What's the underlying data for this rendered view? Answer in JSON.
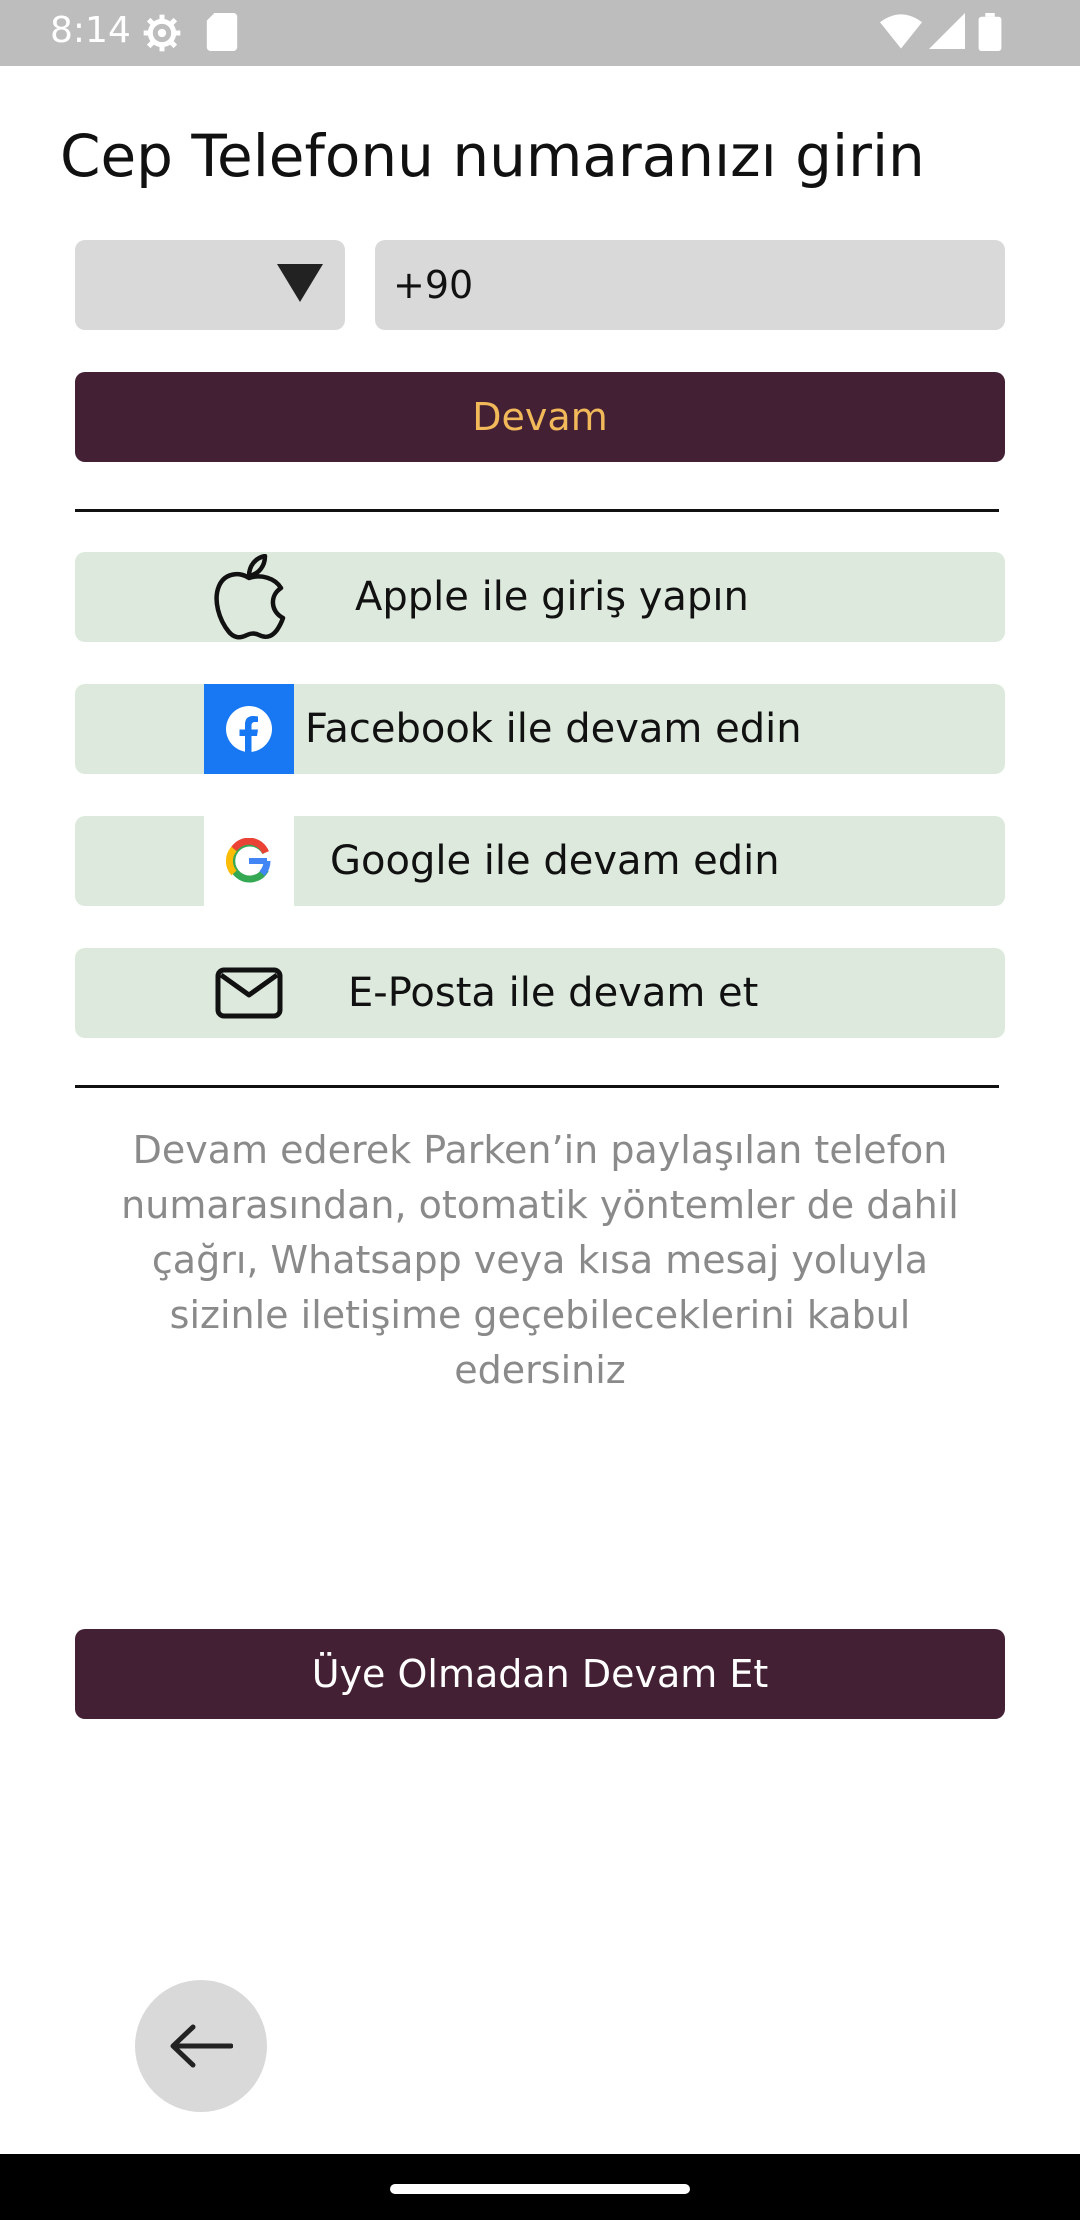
{
  "status_bar": {
    "time": "8:14",
    "icons": [
      "settings-icon",
      "sd-card-icon",
      "wifi-icon",
      "signal-icon",
      "battery-icon"
    ]
  },
  "page": {
    "title": "Cep Telefonu numaranızı girin"
  },
  "phone_form": {
    "country_select_value": "",
    "phone_value": "+90",
    "continue_label": "Devam"
  },
  "social_buttons": [
    {
      "label": "Apple ile giriş yapın",
      "icon": "apple-icon"
    },
    {
      "label": "Facebook ile devam edin",
      "icon": "facebook-icon"
    },
    {
      "label": "Google ile devam edin",
      "icon": "google-icon"
    },
    {
      "label": "E-Posta ile devam et",
      "icon": "mail-icon"
    }
  ],
  "disclaimer": "Devam ederek Parken’in paylaşılan telefon numarasından, otomatik yöntemler de dahil çağrı, Whatsapp veya kısa mesaj yoluyla sizinle iletişime geçebileceklerini kabul edersiniz",
  "guest_button_label": "Üye Olmadan Devam Et",
  "colors": {
    "primary": "#432033",
    "continue_text": "#f2b95a",
    "social_bg": "#dde9dd",
    "input_bg": "#d9d9d9",
    "facebook": "#1877f2"
  }
}
